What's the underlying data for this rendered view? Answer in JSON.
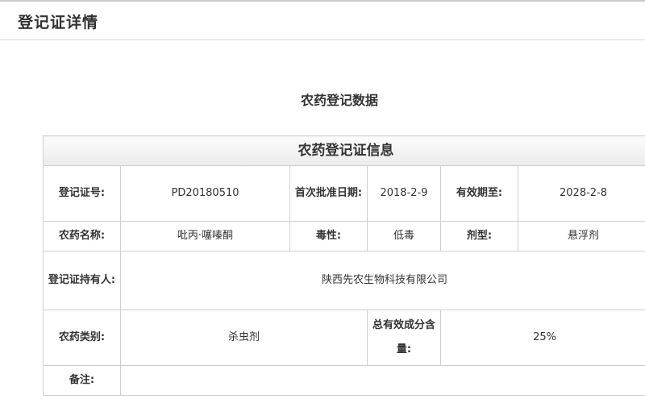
{
  "header": {
    "title": "登记证详情"
  },
  "main": {
    "section_title": "农药登记数据"
  },
  "registration": {
    "table_title": "农药登记证信息",
    "cert_no_label": "登记证号:",
    "cert_no": "PD20180510",
    "first_approval_label": "首次批准日期:",
    "first_approval_date": "2018-2-9",
    "valid_until_label": "有效期至:",
    "valid_until": "2028-2-8",
    "name_label": "农药名称:",
    "name": "吡丙·噻嗪酮",
    "toxicity_label": "毒性:",
    "toxicity": "低毒",
    "formulation_label": "剂型:",
    "formulation": "悬浮剂",
    "holder_label": "登记证持有人:",
    "holder": "陕西先农生物科技有限公司",
    "category_label": "农药类别:",
    "category": "杀虫剂",
    "content_label": "总有效成分含量:",
    "content": "25%",
    "remarks_label": "备注:",
    "remarks": ""
  }
}
